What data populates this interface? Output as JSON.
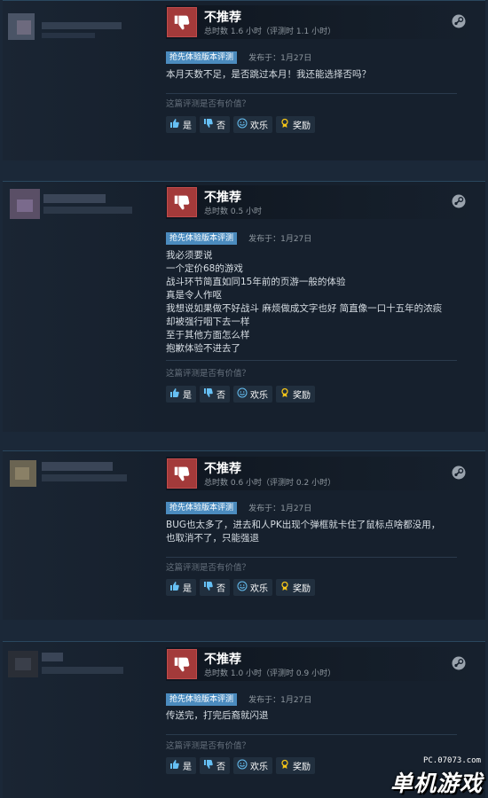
{
  "labels": {
    "not_recommended": "不推荐",
    "early_access_badge": "抢先体验版本评测",
    "helpful_question": "这篇评测是否有价值？",
    "btn_yes": "是",
    "btn_no": "否",
    "btn_funny": "欢乐",
    "btn_award": "奖励"
  },
  "reviews": [
    {
      "hours": "总时数 1.6 小时（评测时 1.1 小时）",
      "posted": "发布于：1月27日",
      "lines": [
        "本月天数不足，是否跳过本月！我还能选择否吗？"
      ]
    },
    {
      "hours": "总时数 0.5 小时",
      "posted": "发布于：1月27日",
      "lines": [
        "我必须要说",
        "一个定价68的游戏",
        "战斗环节简直如同15年前的页游一般的体验",
        "真是令人作呕",
        "我想说如果做不好战斗 麻烦做成文字也好 简直像一口十五年的浓痰",
        "却被强行咽下去一样",
        "至于其他方面怎么样",
        "抱歉体验不进去了"
      ]
    },
    {
      "hours": "总时数 0.6 小时（评测时 0.2 小时）",
      "posted": "发布于：1月27日",
      "lines": [
        "BUG也太多了，进去和人PK出现个弹框就卡住了鼠标点啥都没用，",
        "也取消不了，只能强退"
      ]
    },
    {
      "hours": "总时数 1.0 小时（评测时 0.9 小时）",
      "posted": "发布于：1月27日",
      "lines": [
        "传送完，打完后裔就闪退"
      ]
    }
  ],
  "watermark": {
    "site": "PC.07073.com",
    "text": "单机游戏"
  },
  "colors": {
    "background": "#1b2838",
    "card": "#16202d",
    "thumb_down": "#a33a3a",
    "badge": "#4b8bbe",
    "link": "#66c0f4"
  }
}
